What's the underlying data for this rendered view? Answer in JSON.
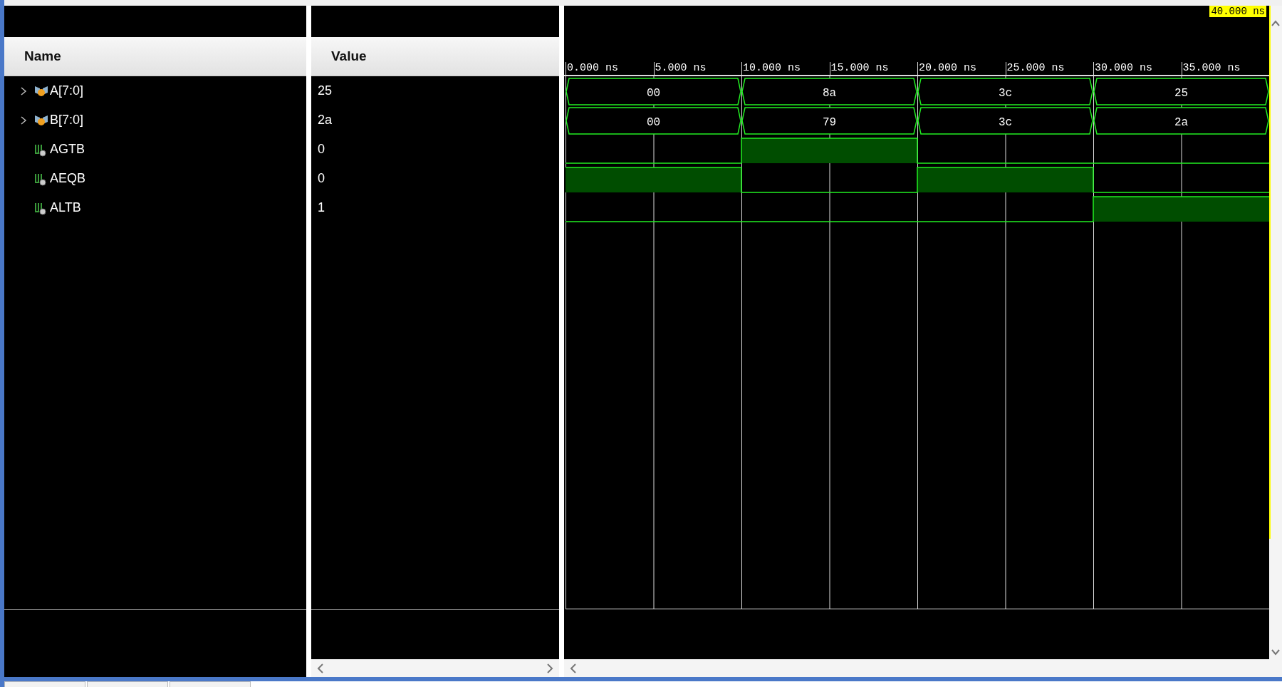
{
  "header": {
    "name_column": "Name",
    "value_column": "Value"
  },
  "cursor": {
    "time": "40.000 ns"
  },
  "time_ticks": [
    "0.000 ns",
    "5.000 ns",
    "10.000 ns",
    "15.000 ns",
    "20.000 ns",
    "25.000 ns",
    "30.000 ns",
    "35.000 ns"
  ],
  "signals": [
    {
      "name": "A[7:0]",
      "value": "25",
      "kind": "bus",
      "expanded": false,
      "segments": [
        "00",
        "8a",
        "3c",
        "25"
      ]
    },
    {
      "name": "B[7:0]",
      "value": "2a",
      "kind": "bus",
      "expanded": false,
      "segments": [
        "00",
        "79",
        "3c",
        "2a"
      ]
    },
    {
      "name": "AGTB",
      "value": "0",
      "kind": "bit",
      "segments": [
        {
          "high": false
        },
        {
          "high": true
        },
        {
          "high": false
        },
        {
          "high": false
        }
      ]
    },
    {
      "name": "AEQB",
      "value": "0",
      "kind": "bit",
      "segments": [
        {
          "high": true
        },
        {
          "high": false
        },
        {
          "high": true
        },
        {
          "high": false
        }
      ]
    },
    {
      "name": "ALTB",
      "value": "1",
      "kind": "bit",
      "segments": [
        {
          "high": false
        },
        {
          "high": false
        },
        {
          "high": false
        },
        {
          "high": true
        }
      ]
    }
  ]
}
